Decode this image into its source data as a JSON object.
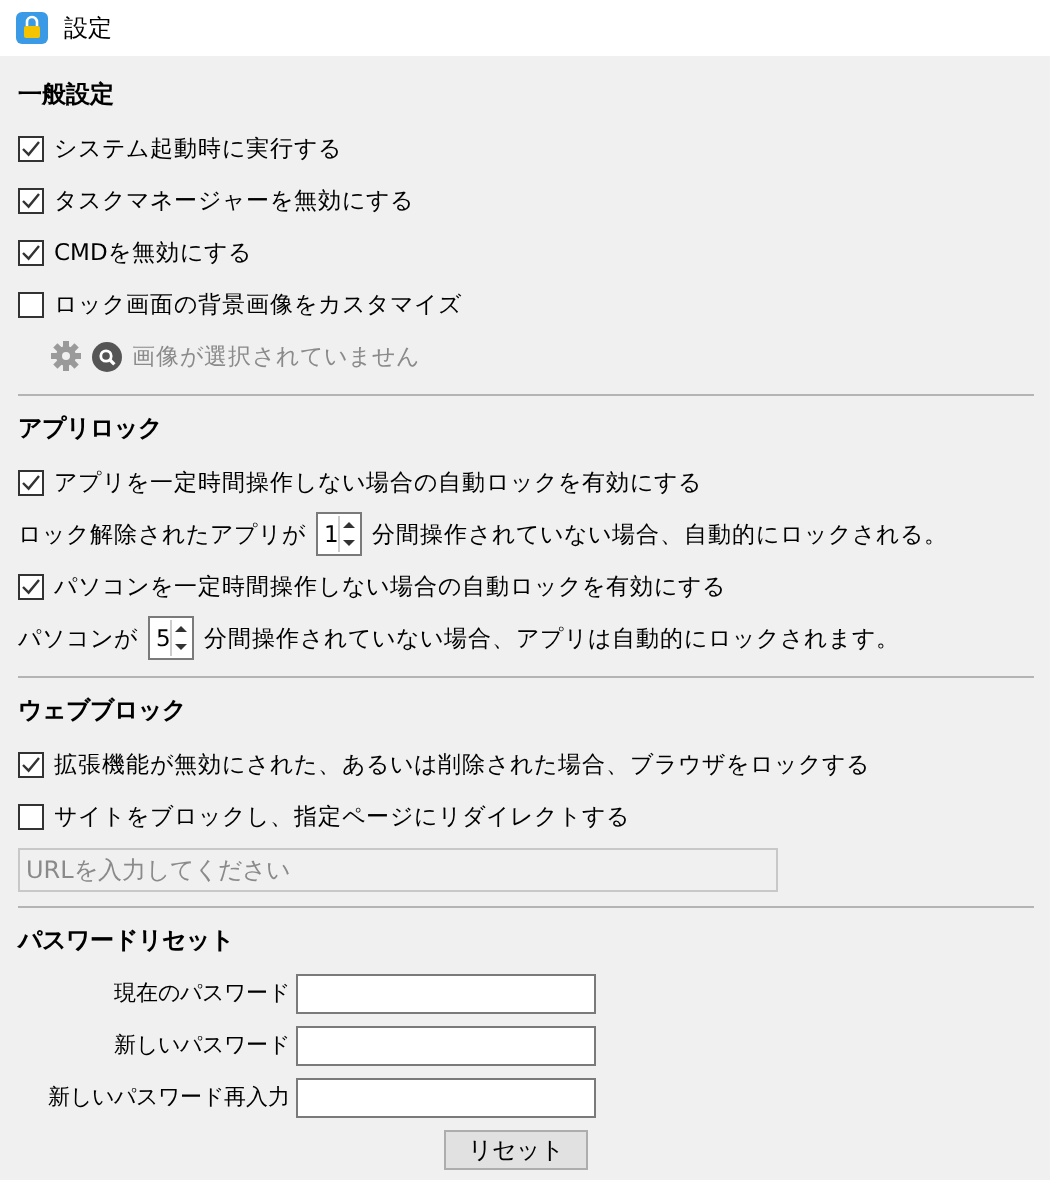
{
  "window": {
    "title": "設定"
  },
  "sections": [
    {
      "heading": "一般設定",
      "items": [
        {
          "kind": "checkbox",
          "label": "システム起動時に実行する",
          "checked": true
        },
        {
          "kind": "checkbox",
          "label": "タスクマネージャーを無効にする",
          "checked": true
        },
        {
          "kind": "checkbox",
          "label": "CMDを無効にする",
          "checked": true
        },
        {
          "kind": "checkbox",
          "label": "ロック画面の背景画像をカスタマイズ",
          "checked": false
        },
        {
          "kind": "image-picker",
          "status": "画像が選択されていません",
          "disabled": true
        }
      ]
    },
    {
      "heading": "アプリロック",
      "items": [
        {
          "kind": "checkbox",
          "label": "アプリを一定時間操作しない場合の自動ロックを有効にする",
          "checked": true
        },
        {
          "kind": "spinner",
          "prefix": "ロック解除されたアプリが",
          "value": "1",
          "suffix": "分間操作されていない場合、自動的にロックされる。"
        },
        {
          "kind": "checkbox",
          "label": "パソコンを一定時間操作しない場合の自動ロックを有効にする",
          "checked": true
        },
        {
          "kind": "spinner",
          "prefix": "パソコンが",
          "value": "5",
          "suffix": "分間操作されていない場合、アプリは自動的にロックされます。"
        }
      ]
    },
    {
      "heading": "ウェブブロック",
      "items": [
        {
          "kind": "checkbox",
          "label": "拡張機能が無効にされた、あるいは削除された場合、ブラウザをロックする",
          "checked": true
        },
        {
          "kind": "checkbox",
          "label": "サイトをブロックし、指定ページにリダイレクトする",
          "checked": false
        },
        {
          "kind": "url-field",
          "placeholder": "URLを入力してください",
          "disabled": true
        }
      ]
    },
    {
      "heading": "パスワードリセット",
      "items": [
        {
          "kind": "password-field",
          "label": "現在のパスワード"
        },
        {
          "kind": "password-field",
          "label": "新しいパスワード"
        },
        {
          "kind": "password-field",
          "label": "新しいパスワード再入力"
        },
        {
          "kind": "button",
          "label": "リセット"
        }
      ]
    }
  ]
}
